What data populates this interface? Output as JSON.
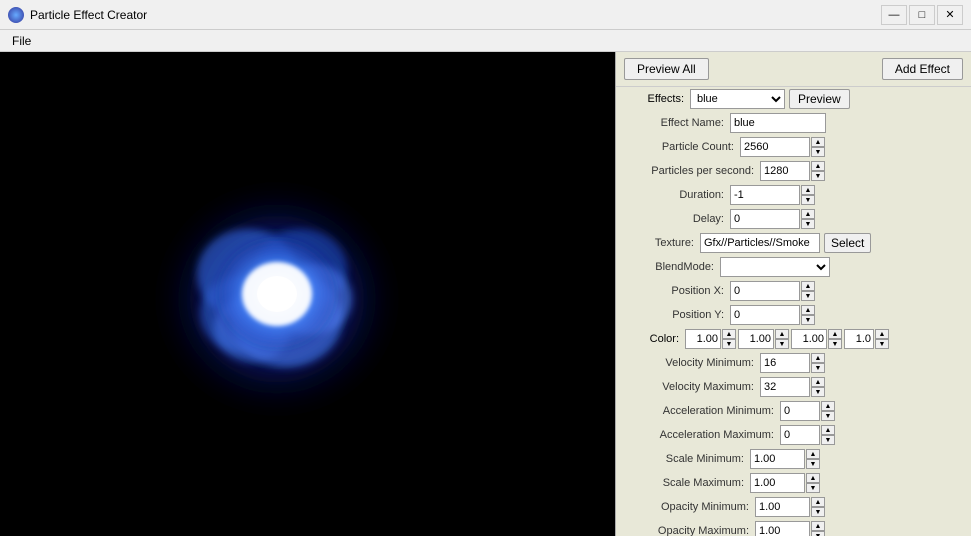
{
  "titleBar": {
    "title": "Particle Effect Creator",
    "minimizeLabel": "—",
    "maximizeLabel": "□",
    "closeLabel": "✕"
  },
  "menuBar": {
    "items": [
      "File"
    ]
  },
  "panel": {
    "previewAllLabel": "Preview All",
    "addEffectLabel": "Add Effect",
    "previewLabel": "Preview",
    "effectsLabel": "Effects:",
    "effectsValue": "blue",
    "effectNameLabel": "Effect Name:",
    "effectNameValue": "blue",
    "particleCountLabel": "Particle Count:",
    "particleCountValue": "2560",
    "particlesPerSecondLabel": "Particles per second:",
    "particlesPerSecondValue": "1280",
    "durationLabel": "Duration:",
    "durationValue": "-1",
    "delayLabel": "Delay:",
    "delayValue": "0",
    "textureLabel": "Texture:",
    "textureValue": "Gfx//Particles//Smoke",
    "selectLabel": "Select",
    "blendModeLabel": "BlendMode:",
    "blendModeValue": "",
    "positionXLabel": "Position X:",
    "positionXValue": "0",
    "positionYLabel": "Position Y:",
    "positionYValue": "0",
    "colorLabel": "Color:",
    "colorR": "1.00",
    "colorG": "1.00",
    "colorB": "1.00",
    "colorA": "1.0",
    "velocityMinLabel": "Velocity Minimum:",
    "velocityMinValue": "16",
    "velocityMaxLabel": "Velocity Maximum:",
    "velocityMaxValue": "32",
    "accelMinLabel": "Acceleration Minimum:",
    "accelMinValue": "0",
    "accelMaxLabel": "Acceleration Maximum:",
    "accelMaxValue": "0",
    "scaleMinLabel": "Scale Minimum:",
    "scaleMinValue": "1.00",
    "scaleMaxLabel": "Scale Maximum:",
    "scaleMaxValue": "1.00",
    "opacityMinLabel": "Opacity Minimum:",
    "opacityMinValue": "1.00",
    "opacityMaxLabel": "Opacity Maximum:",
    "opacityMaxValue": "1.00"
  }
}
